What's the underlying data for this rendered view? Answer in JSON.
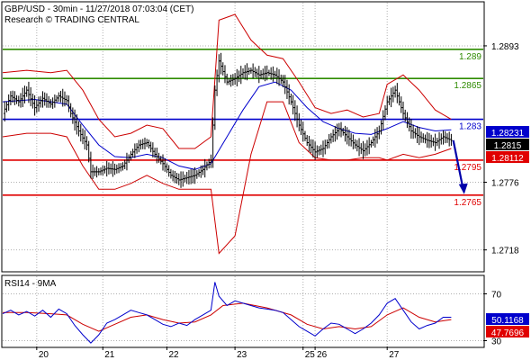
{
  "header": {
    "line1": "GBP/USD - 30min - 11/27/2018 07:03:04 (CET)",
    "line2": "Research © TRADING CENTRAL"
  },
  "rsi_label": "RSI14 - 9MA",
  "colors": {
    "price": "#000000",
    "bollinger": "#cc0000",
    "ma": "#0000cc",
    "resistance": "#2e8b00",
    "pivot": "#0000cc",
    "support": "#e00000",
    "arrow": "#0000aa",
    "grid": "#b0b0b0"
  },
  "chart_data": [
    {
      "type": "line",
      "name": "GBP/USD 30min price chart",
      "ylim": [
        1.27,
        1.293
      ],
      "y_ticks": [
        "1.2893",
        "1.2776",
        "1.2718"
      ],
      "x_ticks": [
        "20",
        "21",
        "22",
        "23",
        "25",
        "26",
        "27"
      ],
      "grid": true,
      "levels": [
        {
          "label": "1.289",
          "value": 1.289,
          "role": "resistance"
        },
        {
          "label": "1.2865",
          "value": 1.2865,
          "role": "resistance"
        },
        {
          "label": "1.283",
          "value": 1.283,
          "role": "pivot"
        },
        {
          "label": "1.2795",
          "value": 1.2795,
          "role": "support"
        },
        {
          "label": "1.2765",
          "value": 1.2765,
          "role": "support"
        }
      ],
      "price_tags": [
        {
          "label": "1.28231",
          "value": 1.28231,
          "color": "#0000cc"
        },
        {
          "label": "1.2815",
          "value": 1.2815,
          "color": "#000000"
        },
        {
          "label": "1.28112",
          "value": 1.28112,
          "color": "#e00000"
        }
      ],
      "forecast": {
        "from": 1.2812,
        "to": 1.2765,
        "direction": "down"
      },
      "price": [
        [
          0,
          1.2835
        ],
        [
          4,
          1.285
        ],
        [
          8,
          1.2845
        ],
        [
          12,
          1.2855
        ],
        [
          16,
          1.284
        ],
        [
          20,
          1.2848
        ],
        [
          24,
          1.2843
        ],
        [
          28,
          1.285
        ],
        [
          32,
          1.2846
        ],
        [
          34,
          1.2835
        ],
        [
          38,
          1.282
        ],
        [
          42,
          1.2808
        ],
        [
          44,
          1.2785
        ],
        [
          48,
          1.2785
        ],
        [
          52,
          1.2788
        ],
        [
          56,
          1.2787
        ],
        [
          60,
          1.279
        ],
        [
          64,
          1.28
        ],
        [
          68,
          1.2808
        ],
        [
          72,
          1.281
        ],
        [
          76,
          1.28
        ],
        [
          80,
          1.2792
        ],
        [
          84,
          1.2782
        ],
        [
          88,
          1.2778
        ],
        [
          92,
          1.278
        ],
        [
          96,
          1.2782
        ],
        [
          100,
          1.2787
        ],
        [
          104,
          1.2795
        ],
        [
          106,
          1.2855
        ],
        [
          108,
          1.288
        ],
        [
          112,
          1.2862
        ],
        [
          116,
          1.2865
        ],
        [
          120,
          1.287
        ],
        [
          124,
          1.2872
        ],
        [
          128,
          1.2868
        ],
        [
          132,
          1.287
        ],
        [
          136,
          1.2868
        ],
        [
          140,
          1.2862
        ],
        [
          144,
          1.2845
        ],
        [
          148,
          1.2825
        ],
        [
          152,
          1.281
        ],
        [
          156,
          1.2802
        ],
        [
          160,
          1.2805
        ],
        [
          164,
          1.2815
        ],
        [
          168,
          1.2822
        ],
        [
          172,
          1.2815
        ],
        [
          176,
          1.2808
        ],
        [
          180,
          1.2803
        ],
        [
          184,
          1.281
        ],
        [
          188,
          1.282
        ],
        [
          192,
          1.2845
        ],
        [
          196,
          1.2855
        ],
        [
          200,
          1.2835
        ],
        [
          204,
          1.282
        ],
        [
          208,
          1.2815
        ],
        [
          212,
          1.2812
        ],
        [
          216,
          1.281
        ],
        [
          220,
          1.2815
        ],
        [
          224,
          1.2812
        ]
      ],
      "ma": [
        [
          0,
          1.2845
        ],
        [
          16,
          1.2847
        ],
        [
          32,
          1.2843
        ],
        [
          40,
          1.2825
        ],
        [
          48,
          1.2808
        ],
        [
          56,
          1.2798
        ],
        [
          64,
          1.2797
        ],
        [
          72,
          1.28
        ],
        [
          80,
          1.2797
        ],
        [
          88,
          1.279
        ],
        [
          96,
          1.2787
        ],
        [
          104,
          1.2792
        ],
        [
          112,
          1.2815
        ],
        [
          120,
          1.2838
        ],
        [
          128,
          1.2858
        ],
        [
          136,
          1.2862
        ],
        [
          144,
          1.2855
        ],
        [
          152,
          1.284
        ],
        [
          160,
          1.2828
        ],
        [
          168,
          1.2822
        ],
        [
          176,
          1.2818
        ],
        [
          184,
          1.2817
        ],
        [
          192,
          1.2822
        ],
        [
          200,
          1.2828
        ],
        [
          208,
          1.2823
        ],
        [
          216,
          1.282
        ],
        [
          224,
          1.2821
        ]
      ],
      "bollinger_upper": [
        [
          0,
          1.287
        ],
        [
          12,
          1.2872
        ],
        [
          24,
          1.287
        ],
        [
          32,
          1.2872
        ],
        [
          40,
          1.2855
        ],
        [
          48,
          1.283
        ],
        [
          56,
          1.2815
        ],
        [
          64,
          1.2818
        ],
        [
          72,
          1.2825
        ],
        [
          80,
          1.2822
        ],
        [
          88,
          1.2805
        ],
        [
          96,
          1.2805
        ],
        [
          104,
          1.2815
        ],
        [
          108,
          1.2915
        ],
        [
          116,
          1.292
        ],
        [
          124,
          1.2898
        ],
        [
          132,
          1.2885
        ],
        [
          140,
          1.2882
        ],
        [
          148,
          1.2862
        ],
        [
          156,
          1.284
        ],
        [
          164,
          1.2835
        ],
        [
          172,
          1.2838
        ],
        [
          180,
          1.2832
        ],
        [
          188,
          1.2835
        ],
        [
          192,
          1.286
        ],
        [
          200,
          1.2868
        ],
        [
          208,
          1.2855
        ],
        [
          216,
          1.2838
        ],
        [
          224,
          1.283
        ]
      ],
      "bollinger_lower": [
        [
          0,
          1.2815
        ],
        [
          12,
          1.2818
        ],
        [
          24,
          1.2818
        ],
        [
          32,
          1.2815
        ],
        [
          40,
          1.279
        ],
        [
          48,
          1.277
        ],
        [
          56,
          1.277
        ],
        [
          64,
          1.2775
        ],
        [
          72,
          1.2782
        ],
        [
          80,
          1.2775
        ],
        [
          88,
          1.277
        ],
        [
          96,
          1.277
        ],
        [
          104,
          1.277
        ],
        [
          108,
          1.2715
        ],
        [
          116,
          1.273
        ],
        [
          124,
          1.28
        ],
        [
          132,
          1.2845
        ],
        [
          140,
          1.2845
        ],
        [
          148,
          1.281
        ],
        [
          156,
          1.2797
        ],
        [
          164,
          1.2795
        ],
        [
          172,
          1.2795
        ],
        [
          180,
          1.2797
        ],
        [
          188,
          1.2797
        ],
        [
          192,
          1.2795
        ],
        [
          200,
          1.28
        ],
        [
          208,
          1.2797
        ],
        [
          216,
          1.28
        ],
        [
          224,
          1.2805
        ]
      ]
    },
    {
      "type": "line",
      "name": "RSI14 - 9MA",
      "ylim": [
        25,
        85
      ],
      "y_ticks": [
        "70",
        "30"
      ],
      "value_tags": [
        {
          "label": "50.1168",
          "value": 50.1168,
          "color": "#0000cc"
        },
        {
          "label": "47.7696",
          "value": 47.7696,
          "color": "#e00000"
        }
      ],
      "rsi": [
        [
          0,
          53
        ],
        [
          4,
          56
        ],
        [
          8,
          52
        ],
        [
          12,
          55
        ],
        [
          16,
          51
        ],
        [
          20,
          56
        ],
        [
          24,
          50
        ],
        [
          28,
          57
        ],
        [
          32,
          53
        ],
        [
          36,
          43
        ],
        [
          40,
          35
        ],
        [
          44,
          28
        ],
        [
          48,
          35
        ],
        [
          52,
          45
        ],
        [
          56,
          48
        ],
        [
          60,
          52
        ],
        [
          64,
          56
        ],
        [
          68,
          54
        ],
        [
          72,
          52
        ],
        [
          76,
          48
        ],
        [
          80,
          44
        ],
        [
          84,
          42
        ],
        [
          88,
          45
        ],
        [
          92,
          43
        ],
        [
          96,
          48
        ],
        [
          100,
          52
        ],
        [
          104,
          56
        ],
        [
          106,
          80
        ],
        [
          108,
          68
        ],
        [
          112,
          60
        ],
        [
          116,
          64
        ],
        [
          120,
          62
        ],
        [
          124,
          60
        ],
        [
          128,
          58
        ],
        [
          132,
          57
        ],
        [
          136,
          56
        ],
        [
          140,
          54
        ],
        [
          144,
          48
        ],
        [
          148,
          42
        ],
        [
          152,
          38
        ],
        [
          156,
          34
        ],
        [
          160,
          40
        ],
        [
          164,
          45
        ],
        [
          168,
          44
        ],
        [
          172,
          40
        ],
        [
          176,
          36
        ],
        [
          180,
          40
        ],
        [
          184,
          45
        ],
        [
          188,
          52
        ],
        [
          192,
          62
        ],
        [
          196,
          66
        ],
        [
          200,
          56
        ],
        [
          204,
          46
        ],
        [
          208,
          40
        ],
        [
          212,
          43
        ],
        [
          216,
          45
        ],
        [
          220,
          50
        ],
        [
          224,
          50
        ]
      ],
      "ma": [
        [
          0,
          54
        ],
        [
          12,
          54
        ],
        [
          24,
          53
        ],
        [
          32,
          52
        ],
        [
          40,
          44
        ],
        [
          48,
          38
        ],
        [
          56,
          44
        ],
        [
          64,
          50
        ],
        [
          72,
          52
        ],
        [
          80,
          48
        ],
        [
          88,
          45
        ],
        [
          96,
          46
        ],
        [
          104,
          52
        ],
        [
          110,
          60
        ],
        [
          120,
          62
        ],
        [
          132,
          58
        ],
        [
          144,
          52
        ],
        [
          152,
          44
        ],
        [
          160,
          40
        ],
        [
          168,
          42
        ],
        [
          176,
          40
        ],
        [
          184,
          42
        ],
        [
          192,
          52
        ],
        [
          200,
          58
        ],
        [
          208,
          50
        ],
        [
          216,
          46
        ],
        [
          224,
          48
        ]
      ]
    }
  ]
}
